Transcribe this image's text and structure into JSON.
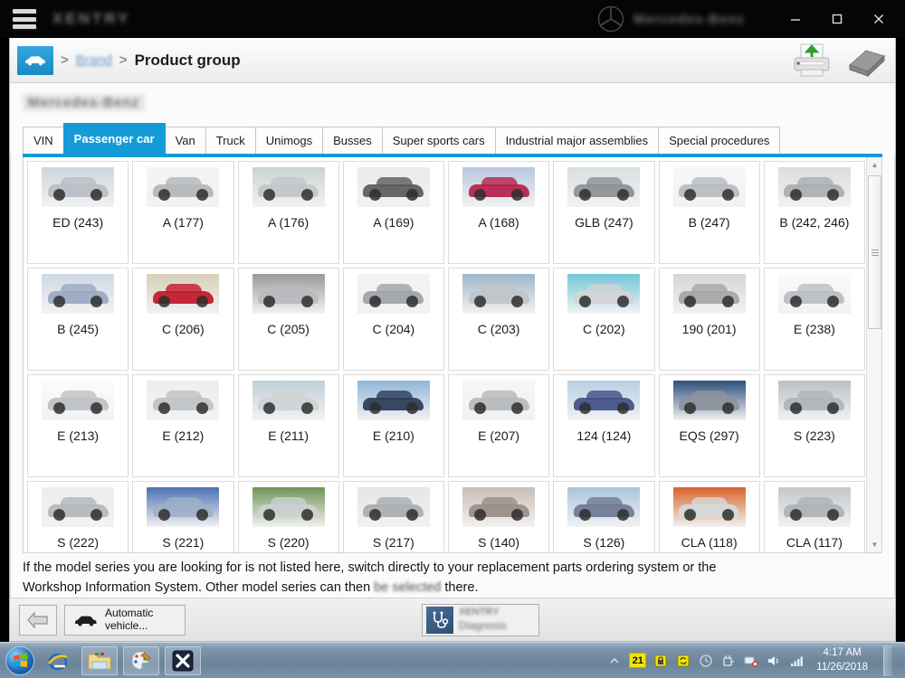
{
  "titlebar": {
    "app_title_redacted": "XENTRY",
    "brand_text_redacted": "Mercedes-Benz",
    "minimize_label": "Minimize",
    "maximize_label": "Maximize",
    "close_label": "Close"
  },
  "breadcrumb": {
    "home_icon": "car-icon",
    "separator": ">",
    "link_label": "Brand",
    "current_label": "Product group",
    "print_icon": "printer-upload-icon",
    "manual_icon": "book-icon"
  },
  "vin": {
    "value_redacted": "Mercedes-Benz"
  },
  "tabs": [
    {
      "label": "VIN",
      "active": false
    },
    {
      "label": "Passenger car",
      "active": true
    },
    {
      "label": "Van",
      "active": false
    },
    {
      "label": "Truck",
      "active": false
    },
    {
      "label": "Unimogs",
      "active": false
    },
    {
      "label": "Busses",
      "active": false
    },
    {
      "label": "Super sports cars",
      "active": false
    },
    {
      "label": "Industrial major assemblies",
      "active": false
    },
    {
      "label": "Special procedures",
      "active": false
    }
  ],
  "grid": {
    "items": [
      {
        "label": "ED (243)",
        "color": "#b9bec4",
        "sky": "#cfd6dd"
      },
      {
        "label": "A (177)",
        "color": "#b3b6ba",
        "sky": "#f4f4f4"
      },
      {
        "label": "A (176)",
        "color": "#c2c6c9",
        "sky": "#c9d4d2"
      },
      {
        "label": "A (169)",
        "color": "#5a5a5c",
        "sky": "#eaeaea"
      },
      {
        "label": "A (168)",
        "color": "#b51f4a",
        "sky": "#b9c6e0"
      },
      {
        "label": "GLB (247)",
        "color": "#8b8f94",
        "sky": "#dadfe2"
      },
      {
        "label": "B (247)",
        "color": "#b6babe",
        "sky": "#f7f7f7"
      },
      {
        "label": "B (242, 246)",
        "color": "#a9adb2",
        "sky": "#dcdcdc"
      },
      {
        "label": "B (245)",
        "color": "#9aa8c0",
        "sky": "#cfd9e6"
      },
      {
        "label": "C (206)",
        "color": "#c01828",
        "sky": "#d9cfb9"
      },
      {
        "label": "C (205)",
        "color": "#b7babe",
        "sky": "#9a9a9a"
      },
      {
        "label": "C (204)",
        "color": "#9ea2a6",
        "sky": "#f3f3f3"
      },
      {
        "label": "C (203)",
        "color": "#c0c4c8",
        "sky": "#9db6c9"
      },
      {
        "label": "C (202)",
        "color": "#d2d4d6",
        "sky": "#73c6d8"
      },
      {
        "label": "190 (201)",
        "color": "#a3a5a7",
        "sky": "#d6d6d6"
      },
      {
        "label": "E (238)",
        "color": "#b9bdc1",
        "sky": "#fafafa"
      },
      {
        "label": "E (213)",
        "color": "#bcc0c4",
        "sky": "#fbfbfb"
      },
      {
        "label": "E (212)",
        "color": "#bec2c6",
        "sky": "#eeeeee"
      },
      {
        "label": "E (211)",
        "color": "#cfd3d6",
        "sky": "#bfd0d8"
      },
      {
        "label": "E (210)",
        "color": "#2b3a56",
        "sky": "#8fb6d6"
      },
      {
        "label": "E (207)",
        "color": "#b4b8bc",
        "sky": "#f6f6f6"
      },
      {
        "label": "124 (124)",
        "color": "#3f4f86",
        "sky": "#b7cfe2"
      },
      {
        "label": "EQS (297)",
        "color": "#8d949c",
        "sky": "#2d4f7a"
      },
      {
        "label": "S (223)",
        "color": "#b0b4b8",
        "sky": "#b9c2c6"
      },
      {
        "label": "S (222)",
        "color": "#b3b7ba",
        "sky": "#ededed"
      },
      {
        "label": "S (221)",
        "color": "#9fb0c6",
        "sky": "#4a72b4"
      },
      {
        "label": "S (220)",
        "color": "#ccd0d3",
        "sky": "#6f9456"
      },
      {
        "label": "S (217)",
        "color": "#a8acb0",
        "sky": "#e6e6e6"
      },
      {
        "label": "S (140)",
        "color": "#9a8c86",
        "sky": "#c8bdb6"
      },
      {
        "label": "S (126)",
        "color": "#6c7a92",
        "sky": "#a9c4dc"
      },
      {
        "label": "CLA (118)",
        "color": "#d6d9dc",
        "sky": "#d8642a"
      },
      {
        "label": "CLA (117)",
        "color": "#aeb2b6",
        "sky": "#c4c8cb"
      }
    ]
  },
  "scrollbar": {
    "up_icon": "chevron-up-icon",
    "down_icon": "chevron-down-icon"
  },
  "notice": {
    "line1": "If the model series you are looking for is not listed here, switch directly to your replacement parts ordering system or the",
    "line2_a": "Workshop Information System. Other model series can then ",
    "line2_fuzzy": "be selected",
    "line2_b": " there."
  },
  "bottombar": {
    "back_icon": "back-arrow-icon",
    "automatic_vehicle_line1": "Automatic",
    "automatic_vehicle_line2": "vehicle...",
    "diagnosis_brand_redacted": "XENTRY",
    "diagnosis_label": "Diagnosis",
    "stethoscope_icon": "stethoscope-icon"
  },
  "taskbar": {
    "start_label": "Start",
    "items": [
      {
        "icon": "internet-explorer-icon",
        "framed": false
      },
      {
        "icon": "file-explorer-icon",
        "framed": true
      },
      {
        "icon": "paint-icon",
        "framed": true
      },
      {
        "icon": "xentry-app-icon",
        "framed": true
      }
    ],
    "tray": {
      "show_hidden_icon": "chevron-up-icon",
      "badge_21": "21",
      "lock_icon": "lock-icon",
      "sync_icon": "sync-icon",
      "clock_icon": "clock-icon",
      "plug_icon": "plug-icon",
      "network_error_icon": "network-error-icon",
      "volume_icon": "speaker-icon",
      "signal_icon": "signal-bars-icon",
      "time": "4:17 AM",
      "date": "11/26/2018"
    }
  },
  "colors": {
    "accent_blue": "#149bd7",
    "taskbar_blue": "#7d94ab",
    "tray_yellow": "#f2e500"
  }
}
